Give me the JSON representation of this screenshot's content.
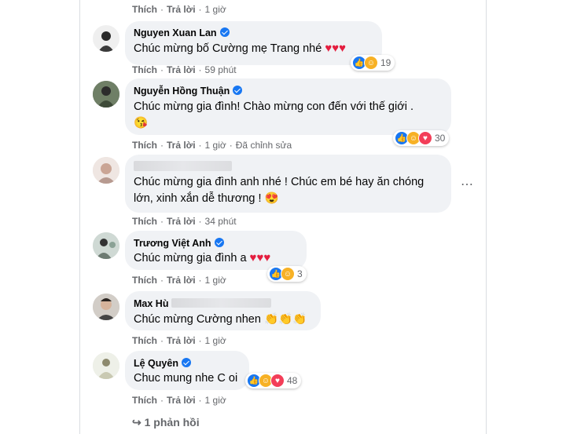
{
  "top_actions": {
    "like": "Thích",
    "reply": "Trả lời",
    "time": "1 giờ"
  },
  "comments": [
    {
      "name": "Nguyen Xuan Lan",
      "verified": true,
      "text": "Chúc mừng bố Cường mẹ Trang nhé",
      "emoji": "♥♥♥",
      "actions": {
        "like": "Thích",
        "reply": "Trả lời",
        "time": "59 phút"
      },
      "reactions": {
        "icons": [
          "like-icon",
          "haha-icon"
        ],
        "count": "19"
      }
    },
    {
      "name": "Nguyễn Hồng Thuận",
      "verified": true,
      "text": "Chúc mừng gia đình! Chào mừng con đến với thế giới .",
      "emoji": "😘",
      "actions": {
        "like": "Thích",
        "reply": "Trả lời",
        "time": "1 giờ",
        "edited": "Đã chỉnh sửa"
      },
      "reactions": {
        "icons": [
          "like-icon",
          "haha-icon",
          "love-icon"
        ],
        "count": "30"
      }
    },
    {
      "name": "",
      "verified": false,
      "text1": "Chúc mừng gia đình anh nhé ! Chúc em bé hay ăn chóng",
      "text2": "lớn, xinh xắn dễ thương !",
      "emoji": "😍",
      "actions": {
        "like": "Thích",
        "reply": "Trả lời",
        "time": "34 phút"
      }
    },
    {
      "name": "Trương Việt Anh",
      "verified": true,
      "text": "Chúc mừng gia đình a",
      "emoji": "♥♥♥",
      "actions": {
        "like": "Thích",
        "reply": "Trả lời",
        "time": "1 giờ"
      },
      "reactions": {
        "icons": [
          "like-icon",
          "haha-icon"
        ],
        "count": "3"
      }
    },
    {
      "name": "Max Hù",
      "verified": false,
      "text": "Chúc mừng Cường nhen",
      "emoji": "👏👏👏",
      "actions": {
        "like": "Thích",
        "reply": "Trả lời",
        "time": "1 giờ"
      }
    },
    {
      "name": "Lệ Quyên",
      "verified": true,
      "text": "Chuc mung nhe C oi",
      "emoji": "",
      "actions": {
        "like": "Thích",
        "reply": "Trả lời",
        "time": "1 giờ"
      },
      "reactions": {
        "icons": [
          "like-icon",
          "haha-icon",
          "love-icon"
        ],
        "count": "48"
      }
    }
  ],
  "more_replies": "1 phản hồi",
  "more_icon": "more-options-icon",
  "colors": {
    "like": "#1877f2",
    "love": "#f33e58",
    "haha": "#f7b125",
    "verified": "#1877f2",
    "bubble": "#f0f2f5",
    "meta": "#65676b"
  }
}
